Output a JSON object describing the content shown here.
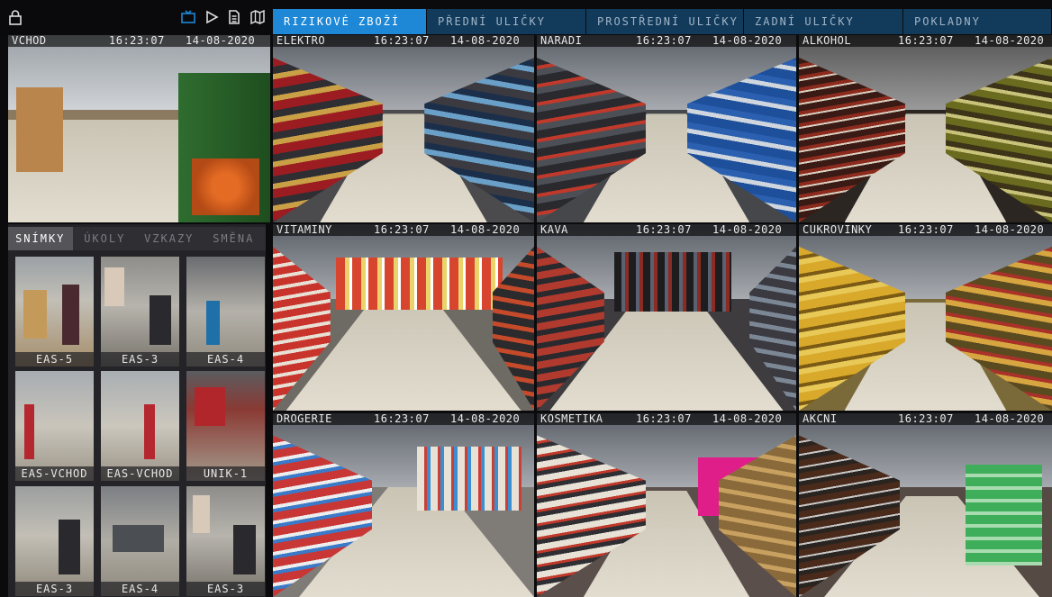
{
  "toolbar": {
    "left_icon": "lock-icon",
    "icons": [
      "monitor-icon",
      "play-icon",
      "document-icon",
      "map-icon"
    ],
    "accent": "#1e88d6"
  },
  "tabs": [
    {
      "label": "RIZIKOVÉ ZBOŽÍ",
      "active": true
    },
    {
      "label": "PŘEDNÍ ULIČKY",
      "active": false
    },
    {
      "label": "PROSTŘEDNÍ ULIČKY",
      "active": false
    },
    {
      "label": "ZADNÍ ULIČKY",
      "active": false
    },
    {
      "label": "POKLADNY",
      "active": false
    }
  ],
  "cameras": [
    {
      "name": "VCHOD",
      "time": "16:23:07",
      "date": "14-08-2020"
    },
    {
      "name": "ELEKTRO",
      "time": "16:23:07",
      "date": "14-08-2020"
    },
    {
      "name": "NARADI",
      "time": "16:23:07",
      "date": "14-08-2020"
    },
    {
      "name": "ALKOHOL",
      "time": "16:23:07",
      "date": "14-08-2020"
    },
    {
      "name": "VITAMINY",
      "time": "16:23:07",
      "date": "14-08-2020"
    },
    {
      "name": "KAVA",
      "time": "16:23:07",
      "date": "14-08-2020"
    },
    {
      "name": "CUKROVINKY",
      "time": "16:23:07",
      "date": "14-08-2020"
    },
    {
      "name": "DROGERIE",
      "time": "16:23:07",
      "date": "14-08-2020"
    },
    {
      "name": "KOSMETIKA",
      "time": "16:23:07",
      "date": "14-08-2020"
    },
    {
      "name": "AKCNI",
      "time": "16:23:07",
      "date": "14-08-2020"
    }
  ],
  "panel": {
    "tabs": [
      {
        "label": "SNÍMKY",
        "active": true
      },
      {
        "label": "ÚKOLY",
        "active": false
      },
      {
        "label": "VZKAZY",
        "active": false
      },
      {
        "label": "SMĚNA",
        "active": false
      }
    ],
    "snapshots": [
      "EAS-5",
      "EAS-3",
      "EAS-4",
      "EAS-VCHOD",
      "EAS-VCHOD",
      "UNIK-1",
      "EAS-3",
      "EAS-4",
      "EAS-3"
    ]
  }
}
